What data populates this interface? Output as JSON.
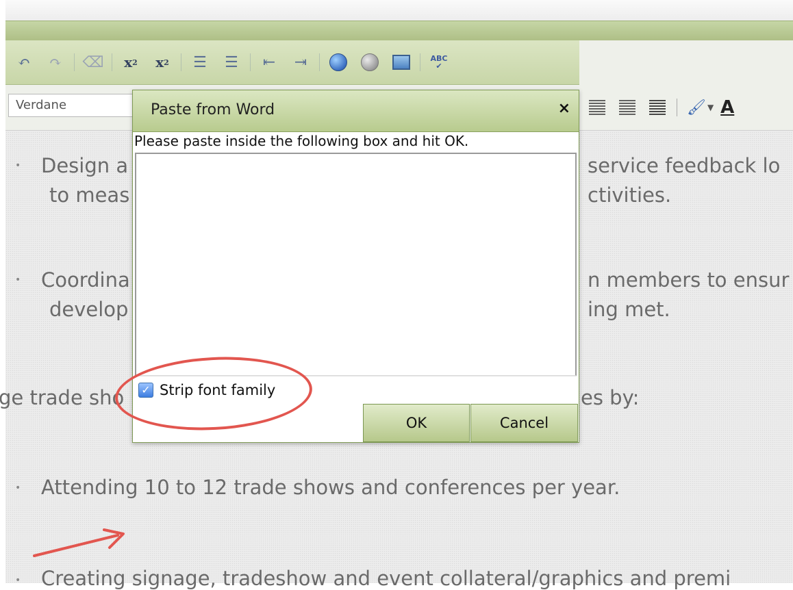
{
  "toolbar": {
    "font_select_value": "Verdane"
  },
  "dialog": {
    "title": "Paste from Word",
    "close_label": "×",
    "message": "Please paste inside the following box and hit OK.",
    "strip_label": "Strip font family",
    "strip_checked": true,
    "ok_label": "OK",
    "cancel_label": "Cancel"
  },
  "document": {
    "lines": [
      {
        "left": "Design a",
        "right": "service feedback lo"
      },
      {
        "left": "to meas",
        "right": "ctivities."
      },
      {
        "left": "Coordina",
        "right": "n members to ensur"
      },
      {
        "left": "develop",
        "right": "ing met."
      },
      {
        "left": "ge trade sho",
        "right": "es by:"
      },
      {
        "text": "Attending 10 to 12 trade shows and conferences per year."
      },
      {
        "text": "Creating signage, tradeshow and event collateral/graphics and premi"
      }
    ]
  },
  "annotation": {
    "circle_color": "#e2564f",
    "arrow_color": "#e2564f"
  },
  "colors": {
    "toolbar_green": "#c8d6a8",
    "dialog_title_green": "#b8cb8e",
    "checkbox_blue": "#3d7de0"
  }
}
